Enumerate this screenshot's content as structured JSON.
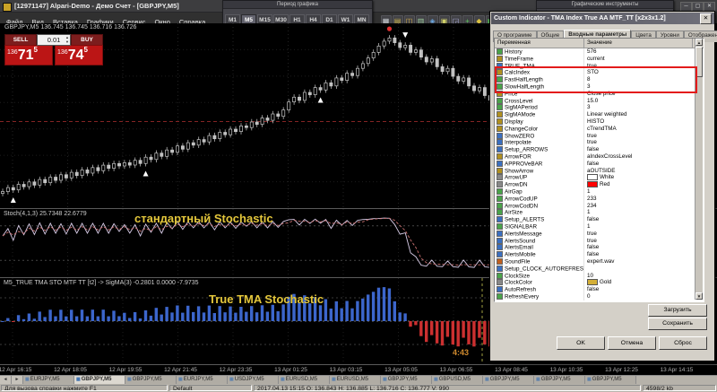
{
  "window": {
    "title": "[12971147] Alpari-Demo - Демо Счет - [GBPJPY,M5]",
    "controls": {
      "minimize": "─",
      "maximize": "▢",
      "close": "✕"
    }
  },
  "menu": {
    "items": [
      "Файл",
      "Вид",
      "Вставка",
      "Графики",
      "Сервис",
      "Окно",
      "Справка"
    ]
  },
  "toolbars": {
    "main": {
      "icons": [
        {
          "name": "new-chart",
          "g": "▦",
          "c": "#cfd3d8"
        },
        {
          "name": "chart-profiles",
          "g": "▤",
          "c": "#c9b24a"
        },
        {
          "name": "market-watch",
          "g": "◫",
          "c": "#e0b84c"
        },
        {
          "name": "data-window",
          "g": "▥",
          "c": "#9fd09f"
        },
        {
          "name": "navigator",
          "g": "◈",
          "c": "#6aa6e0"
        },
        {
          "name": "terminal",
          "g": "▣",
          "c": "#d0d068"
        },
        {
          "name": "strategy-tester",
          "g": "◲",
          "c": "#b0b0e0"
        },
        {
          "name": "new-order",
          "g": "+",
          "c": "#5cc45c"
        },
        {
          "name": "metaeditor",
          "g": "◆",
          "c": "#d8c040"
        },
        {
          "name": "autotrading",
          "g": "▶",
          "c": "#58c058"
        },
        {
          "name": "bar-chart-mode",
          "g": "║",
          "c": "#cfd3d8"
        },
        {
          "name": "candle-chart-mode",
          "g": "▮",
          "c": "#cfd3d8"
        },
        {
          "name": "line-chart-mode",
          "g": "╱",
          "c": "#cfd3d8"
        },
        {
          "name": "zoom-in",
          "g": "+",
          "c": "#cfd3d8"
        },
        {
          "name": "zoom-out",
          "g": "−",
          "c": "#cfd3d8"
        },
        {
          "name": "indicators",
          "g": "ƒ",
          "c": "#e09fe0"
        },
        {
          "name": "templates",
          "g": "▧",
          "c": "#cfd3d8"
        }
      ]
    },
    "period": {
      "title": "Период графика",
      "buttons": [
        "M1",
        "M5",
        "M15",
        "M30",
        "H1",
        "H4",
        "D1",
        "W1",
        "MN"
      ],
      "active": "M5"
    },
    "tools": {
      "title": "Графические инструменты",
      "icons": [
        {
          "name": "cursor",
          "g": "↖"
        },
        {
          "name": "crosshair",
          "g": "+"
        },
        {
          "name": "vertical-line",
          "g": "│"
        },
        {
          "name": "horizontal-line",
          "g": "─"
        },
        {
          "name": "trendline",
          "g": "╱"
        },
        {
          "name": "equidistant-channel",
          "g": "∥"
        },
        {
          "name": "fibonacci",
          "g": "F"
        },
        {
          "name": "text-label",
          "g": "A"
        },
        {
          "name": "arrow-objects",
          "g": "↗"
        },
        {
          "name": "shapes",
          "g": "□"
        }
      ]
    }
  },
  "trade_panel": {
    "sell_label": "SELL",
    "buy_label": "BUY",
    "lot": "0.01",
    "bid": {
      "small": "136",
      "big": "71",
      "sup": "5"
    },
    "ask": {
      "small": "136",
      "big": "74",
      "sup": "5"
    }
  },
  "chart": {
    "symbol_info": "GBPJPY,M5  136.745 136.745 136.716 136.726",
    "stoch_label": "Stoch(4,1,3) 25.7348 22.6779",
    "stoch_caption": "стандартный Stochastic",
    "tma_label": "M5_TRUE TMA STO MTF TT [t2] -> SigMA(3) -0.2801 0.0000 -7.9735",
    "tma_caption": "True TMA Stochastic",
    "countdown": "4:43",
    "time_labels": [
      "12 Apr 16:15",
      "12 Apr 18:05",
      "12 Apr 19:55",
      "12 Apr 21:45",
      "12 Apr 23:35",
      "13 Apr 01:25",
      "13 Apr 03:15",
      "13 Apr 05:05",
      "13 Apr 06:55",
      "13 Apr 08:45",
      "13 Apr 10:35",
      "13 Apr 12:25",
      "13 Apr 14:15"
    ]
  },
  "chart_data": {
    "type": "candlestick-with-oscillators",
    "symbol": "GBPJPY",
    "timeframe": "M5",
    "base": 136.0,
    "closes_milli": [
      340,
      365,
      350,
      385,
      370,
      400,
      380,
      415,
      395,
      430,
      410,
      445,
      425,
      460,
      440,
      475,
      455,
      490,
      470,
      505,
      485,
      515,
      500,
      520,
      505,
      535,
      515,
      555,
      540,
      580,
      560,
      600,
      585,
      625,
      605,
      645,
      630,
      665,
      650,
      690,
      670,
      710,
      695,
      730,
      715,
      750,
      740,
      775,
      760,
      800,
      785,
      825,
      810,
      850,
      900,
      930,
      910,
      960,
      945,
      990,
      975,
      1020,
      1000,
      1050,
      1035,
      1080,
      1065,
      1110,
      1140,
      1175,
      1210,
      1250,
      1280,
      1300,
      1270,
      1240,
      1255,
      1210,
      1225,
      1180,
      1150,
      1170,
      1120,
      1090,
      1110,
      1060,
      1030,
      1050,
      1000,
      970,
      990,
      940,
      910,
      930,
      880,
      850,
      870,
      820,
      790,
      810,
      760,
      730,
      700,
      660,
      620,
      650,
      680,
      640,
      700,
      730,
      690,
      750,
      720,
      760,
      790,
      755,
      800,
      770,
      740,
      710,
      745,
      715,
      685,
      655,
      690,
      660,
      630,
      665,
      700,
      735,
      705,
      745,
      775,
      745,
      777
    ],
    "markers": {
      "up_arrows": [
        2,
        27,
        60,
        100,
        121
      ],
      "down_arrows": [
        76,
        106
      ],
      "sell_dot": [
        73
      ]
    },
    "stoch_levels": [
      20,
      80
    ],
    "colors": {
      "bar": "#c8c8c8",
      "stoch_main": "#d8cce8",
      "stoch_signal": "#c87070",
      "hist_up": "#3c66cc",
      "hist_down": "#cc3030",
      "bid_line": "#b03030"
    }
  },
  "dialog": {
    "title": "Custom Indicator - TMA Index True AA MTF_TT [x2x3x1.2]",
    "close": "✕",
    "tabs": [
      "О программе",
      "Общие",
      "Входные параметры",
      "Цвета",
      "Уровни",
      "Отображение"
    ],
    "active_tab": "Входные параметры",
    "columns": [
      "Переменная",
      "Значение"
    ],
    "params": [
      {
        "n": "History",
        "v": "576",
        "t": "num"
      },
      {
        "n": "TimeFrame",
        "v": "current",
        "t": "enum"
      },
      {
        "n": "TRUE_TMA",
        "v": "true",
        "t": "bool"
      },
      {
        "n": "CalcIndex",
        "v": "STO",
        "t": "enum"
      },
      {
        "n": "FastHalfLength",
        "v": "8",
        "t": "num"
      },
      {
        "n": "SlowHalfLength",
        "v": "3",
        "t": "num"
      },
      {
        "n": "Price",
        "v": "Close price",
        "t": "enum"
      },
      {
        "n": "CrossLevel",
        "v": "15.0",
        "t": "num"
      },
      {
        "n": "SigMAPeriod",
        "v": "3",
        "t": "num"
      },
      {
        "n": "SigMAMode",
        "v": "Linear weighted",
        "t": "enum"
      },
      {
        "n": "Display",
        "v": "HISTO",
        "t": "enum"
      },
      {
        "n": "ChangeColor",
        "v": "cTrendTMA",
        "t": "enum"
      },
      {
        "n": "ShowZERO",
        "v": "true",
        "t": "bool"
      },
      {
        "n": "Interpolate",
        "v": "true",
        "t": "bool"
      },
      {
        "n": "Setup_ARROWS",
        "v": "false",
        "t": "bool"
      },
      {
        "n": "ArrowFOR",
        "v": "aIndexCrossLevel",
        "t": "enum"
      },
      {
        "n": "APPROVeBAR",
        "v": "false",
        "t": "bool"
      },
      {
        "n": "ShowArrow",
        "v": "aOUTSIDE",
        "t": "enum"
      },
      {
        "n": "ArrowUP",
        "v": "White",
        "t": "color",
        "swatch": "#ffffff"
      },
      {
        "n": "ArrowDN",
        "v": "Red",
        "t": "color",
        "swatch": "#ff0000"
      },
      {
        "n": "AirGap",
        "v": "1",
        "t": "num"
      },
      {
        "n": "ArrowCodUP",
        "v": "233",
        "t": "num"
      },
      {
        "n": "ArrowCodDN",
        "v": "234",
        "t": "num"
      },
      {
        "n": "AirSize",
        "v": "1",
        "t": "num"
      },
      {
        "n": "Setup_ALERTS",
        "v": "false",
        "t": "bool"
      },
      {
        "n": "SIGNALBAR",
        "v": "1",
        "t": "num"
      },
      {
        "n": "AlertsMessage",
        "v": "true",
        "t": "bool"
      },
      {
        "n": "AlertsSound",
        "v": "true",
        "t": "bool"
      },
      {
        "n": "AlertsEmail",
        "v": "false",
        "t": "bool"
      },
      {
        "n": "AlertsMobile",
        "v": "false",
        "t": "bool"
      },
      {
        "n": "SoundFile",
        "v": "expert.wav",
        "t": "str"
      },
      {
        "n": "Setup_CLOCK_AUTOREFRESH",
        "v": "",
        "t": "bool"
      },
      {
        "n": "ClockSize",
        "v": "10",
        "t": "num"
      },
      {
        "n": "ClockColor",
        "v": "Gold",
        "t": "color",
        "swatch": "#d4af37"
      },
      {
        "n": "AutoRefresh",
        "v": "false",
        "t": "bool"
      },
      {
        "n": "RefreshEvery",
        "v": "0",
        "t": "num"
      }
    ],
    "highlight_rows": [
      3,
      4,
      5
    ],
    "buttons": {
      "load": "Загрузить",
      "save": "Сохранить",
      "ok": "OK",
      "cancel": "Отмена",
      "reset": "Сброс"
    }
  },
  "chart_tabs": {
    "active_index": 1,
    "items": [
      "EURJPY,M5",
      "GBPJPY,M5",
      "GBPJPY,M5",
      "EURJPY,M5",
      "USDJPY,M5",
      "EURUSD,M5",
      "EURUSD,M5",
      "GBPJPY,M5",
      "GBPUSD,M5",
      "GBPJPY,M5",
      "GBPJPY,M5",
      "GBPJPY,M5"
    ]
  },
  "status": {
    "help": "Для вызова справки нажмите F1",
    "profile": "Default",
    "bar_info": "2017.04.13 15:15   O: 136.843   H: 136.885   L: 136.716   C: 136.777   V: 990",
    "traffic": "4598/2 kb"
  }
}
